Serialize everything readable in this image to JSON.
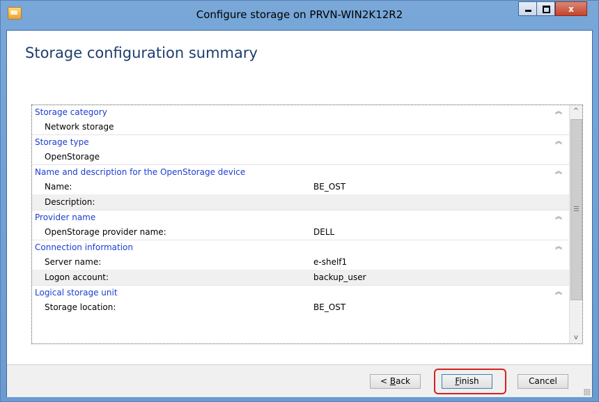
{
  "window": {
    "title": "Configure storage on PRVN-WIN2K12R2",
    "controls": {
      "minimize": "",
      "maximize": "",
      "close": "x"
    }
  },
  "page": {
    "title": "Storage configuration summary"
  },
  "sections": [
    {
      "header": "Storage category",
      "rows": [
        {
          "label": "Network storage",
          "value": ""
        }
      ]
    },
    {
      "header": "Storage type",
      "rows": [
        {
          "label": "OpenStorage",
          "value": ""
        }
      ]
    },
    {
      "header": "Name and description for the OpenStorage device",
      "rows": [
        {
          "label": "Name:",
          "value": "BE_OST"
        },
        {
          "label": "Description:",
          "value": ""
        }
      ]
    },
    {
      "header": "Provider name",
      "rows": [
        {
          "label": "OpenStorage provider name:",
          "value": "DELL"
        }
      ]
    },
    {
      "header": "Connection information",
      "rows": [
        {
          "label": "Server name:",
          "value": "e-shelf1"
        },
        {
          "label": "Logon account:",
          "value": "backup_user"
        }
      ]
    },
    {
      "header": "Logical storage unit",
      "rows": [
        {
          "label": "Storage location:",
          "value": "BE_OST"
        }
      ]
    }
  ],
  "buttons": {
    "back": {
      "mnemonic": "B",
      "rest": "ack",
      "prefix": "< "
    },
    "finish": {
      "mnemonic": "F",
      "rest": "inish"
    },
    "cancel": {
      "label": "Cancel"
    }
  },
  "colors": {
    "section_header": "#1a3ecf",
    "title": "#1e3e6e",
    "highlight": "#d4221e"
  }
}
